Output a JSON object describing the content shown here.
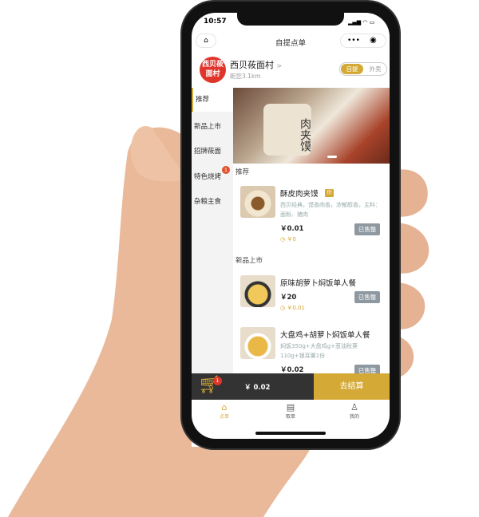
{
  "status": {
    "time": "10:57"
  },
  "nav": {
    "title": "自提点单"
  },
  "shop": {
    "logo_text": "西贝莜面村",
    "name": "西贝莜面村",
    "arrow": ">",
    "distance": "距您3.1km",
    "mode_selected": "自提",
    "mode_other": "外卖"
  },
  "sidebar": {
    "items": [
      {
        "label": "推荐"
      },
      {
        "label": "新品上市"
      },
      {
        "label": "招牌莜面"
      },
      {
        "label": "特色烧烤",
        "badge": "1"
      },
      {
        "label": "杂粮主食"
      }
    ]
  },
  "banner": {
    "text": "肉夹馍"
  },
  "sections": [
    {
      "title": "推荐",
      "items": [
        {
          "name": "酥皮肉夹馍",
          "tag": "份",
          "desc": "西贝经典，馍香肉香，浓郁醇香，主料：面粉、猪肉",
          "price": "￥0.01",
          "member_price": "￥0",
          "status": "已售罄"
        }
      ]
    },
    {
      "title": "新品上市",
      "items": [
        {
          "name": "原味胡萝卜焖饭单人餐",
          "price": "￥20",
          "member_price": "￥0.01",
          "status": "已售罄"
        },
        {
          "name": "大盘鸡+胡萝卜焖饭单人餐",
          "desc": "焖饭350g+大盘鸡g+葱油秋葵110g+银耳羹1份",
          "price": "￥0.02",
          "status": "已售罄"
        }
      ]
    }
  ],
  "cart": {
    "badge": "1",
    "total": "￥ 0.02",
    "checkout": "去结算"
  },
  "tabbar": [
    {
      "label": "点单"
    },
    {
      "label": "取单"
    },
    {
      "label": "我的"
    }
  ],
  "colors": {
    "accent": "#d4a935",
    "dark": "#333333",
    "red": "#e0352b"
  }
}
